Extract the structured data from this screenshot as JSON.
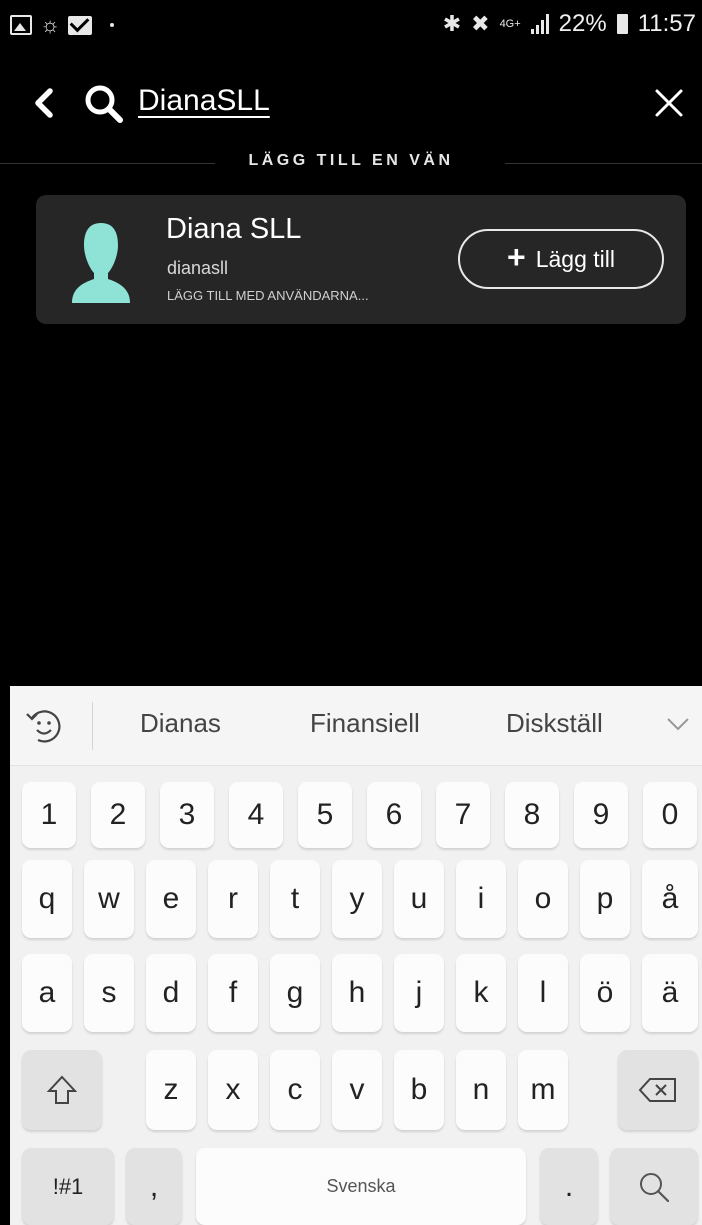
{
  "status_bar": {
    "network": "4G+",
    "battery": "22%",
    "time": "11:57"
  },
  "search": {
    "query": "DianaSLL"
  },
  "section": {
    "title": "LÄGG TILL EN VÄN"
  },
  "result": {
    "display_name": "Diana SLL",
    "username": "dianasll",
    "add_method": "LÄGG TILL MED ANVÄNDARNA...",
    "add_button": {
      "plus": "+",
      "label": "Lägg till"
    }
  },
  "keyboard": {
    "suggestions": [
      "Dianas",
      "Finansiell",
      "Diskställ"
    ],
    "number_row": [
      "1",
      "2",
      "3",
      "4",
      "5",
      "6",
      "7",
      "8",
      "9",
      "0"
    ],
    "row1": [
      "q",
      "w",
      "e",
      "r",
      "t",
      "y",
      "u",
      "i",
      "o",
      "p",
      "å"
    ],
    "row2": [
      "a",
      "s",
      "d",
      "f",
      "g",
      "h",
      "j",
      "k",
      "l",
      "ö",
      "ä"
    ],
    "row3": [
      "z",
      "x",
      "c",
      "v",
      "b",
      "n",
      "m"
    ],
    "symbols_key": "!#1",
    "comma_key": ",",
    "space_label": "Svenska",
    "period_key": "."
  },
  "icons": {
    "back": "chevron-left-icon",
    "search": "search-icon",
    "close": "close-icon",
    "avatar": "person-silhouette-icon",
    "shift": "shift-arrow-icon",
    "backspace": "backspace-icon",
    "emoji": "emoji-switch-icon",
    "keyboard_search": "search-icon",
    "expand": "chevron-down-icon"
  },
  "colors": {
    "background": "#000000",
    "card": "#262626",
    "avatar": "#8ee2d6",
    "keyboard": "#f1f1f1",
    "key": "#fcfcfc"
  }
}
